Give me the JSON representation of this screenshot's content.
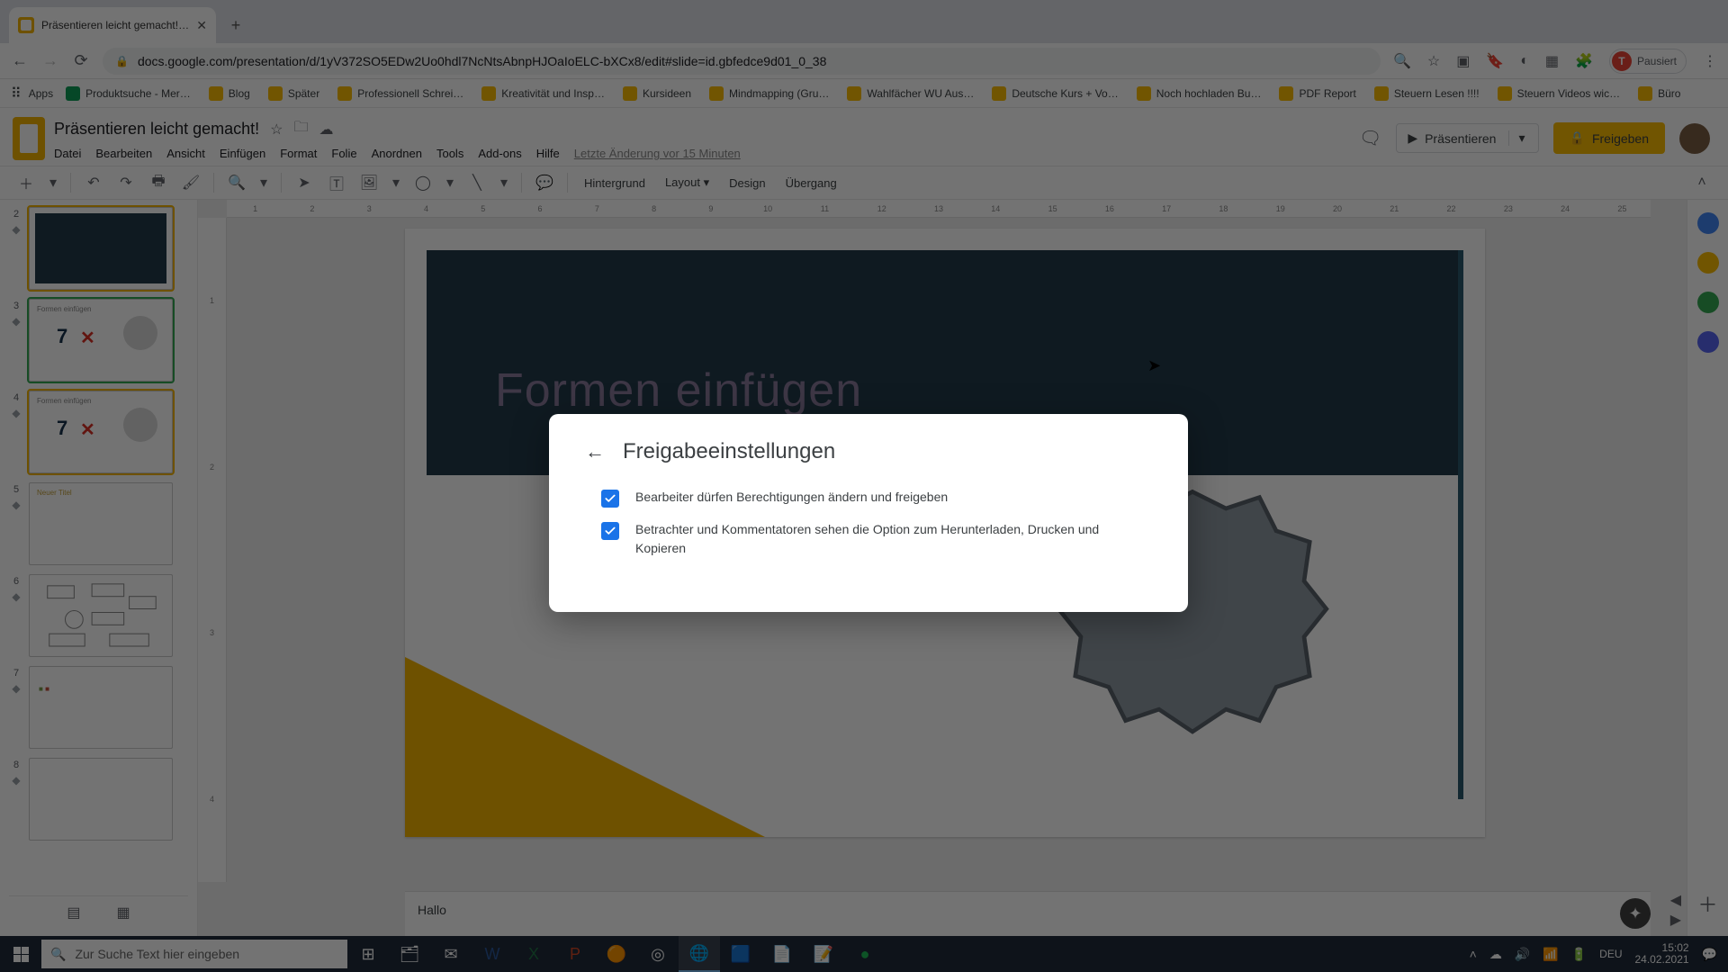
{
  "window": {
    "min": "—",
    "max": "❐",
    "close": "✕"
  },
  "tab": {
    "title": "Präsentieren leicht gemacht! - G",
    "close": "✕"
  },
  "address": {
    "url": "docs.google.com/presentation/d/1yV372SO5EDw2Uo0hdl7NcNtsAbnpHJOaIoELC-bXCx8/edit#slide=id.gbfedce9d01_0_38",
    "profile_status": "Pausiert",
    "profile_initial": "T"
  },
  "bookmarks": {
    "apps_label": "Apps",
    "items": [
      "Produktsuche - Mer…",
      "Blog",
      "Später",
      "Professionell Schrei…",
      "Kreativität und Insp…",
      "Kursideen",
      "Mindmapping  (Gru…",
      "Wahlfächer WU Aus…",
      "Deutsche Kurs + Vo…",
      "Noch hochladen Bu…",
      "PDF Report",
      "Steuern Lesen !!!!",
      "Steuern Videos wic…",
      "Büro"
    ]
  },
  "doc": {
    "title": "Präsentieren leicht gemacht!",
    "menus": [
      "Datei",
      "Bearbeiten",
      "Ansicht",
      "Einfügen",
      "Format",
      "Folie",
      "Anordnen",
      "Tools",
      "Add-ons",
      "Hilfe"
    ],
    "last_edit": "Letzte Änderung vor 15 Minuten",
    "present": "Präsentieren",
    "share": "Freigeben"
  },
  "toolbar": {
    "bg": "Hintergrund",
    "layout": "Layout",
    "design": "Design",
    "transition": "Übergang"
  },
  "ruler_h": [
    "1",
    "2",
    "3",
    "4",
    "5",
    "6",
    "7",
    "8",
    "9",
    "10",
    "11",
    "12",
    "13",
    "14",
    "15",
    "16",
    "17",
    "18",
    "19",
    "20",
    "21",
    "22",
    "23",
    "24",
    "25"
  ],
  "ruler_v": [
    "1",
    "2",
    "3",
    "4"
  ],
  "slide": {
    "title": "Formen einfügen",
    "big7": "7",
    "x": "✕"
  },
  "filmstrip": {
    "nums": [
      "2",
      "3",
      "4",
      "5",
      "6",
      "7",
      "8"
    ]
  },
  "notes": {
    "text": "Hallo"
  },
  "dialog": {
    "title": "Freigabeeinstellungen",
    "opt1": "Bearbeiter dürfen Berechtigungen ändern und freigeben",
    "opt2": "Betrachter und Kommentatoren sehen die Option zum Herunterladen, Drucken und Kopieren"
  },
  "taskbar": {
    "search_placeholder": "Zur Suche Text hier eingeben",
    "lang": "DEU",
    "time": "15:02",
    "date": "24.02.2021"
  }
}
